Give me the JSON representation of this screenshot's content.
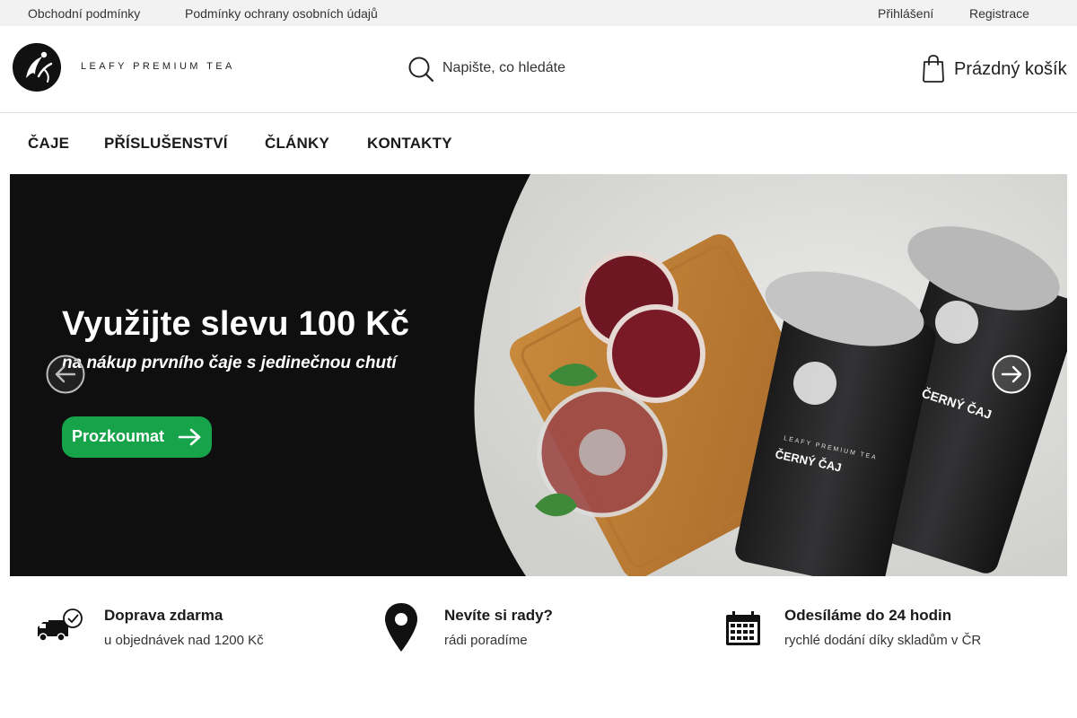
{
  "topbar": {
    "links_left": [
      "Obchodní podmínky",
      "Podmínky ochrany osobních údajů"
    ],
    "links_right": [
      "Přihlášení",
      "Registrace"
    ]
  },
  "header": {
    "logo_text": "LEAFY PREMIUM TEA",
    "search_placeholder": "Napište, co hledáte",
    "cart_label": "Prázdný košík"
  },
  "nav": {
    "items": [
      "ČAJE",
      "PŘÍSLUŠENSTVÍ",
      "ČLÁNKY",
      "KONTAKTY"
    ]
  },
  "banner": {
    "title": "Využijte slevu 100 Kč",
    "subtitle": "na nákup prvního čaje s jedinečnou chutí",
    "button_label": "Prozkoumat",
    "product_logo_text": "LEAFY PREMIUM TEA",
    "product_label": "ČERNÝ ČAJ",
    "colors": {
      "button": "#17a34a",
      "background": "#0f0f10"
    }
  },
  "features": [
    {
      "icon": "delivery-truck-icon",
      "title": "Doprava zdarma",
      "subtitle": "u objednávek nad 1200 Kč"
    },
    {
      "icon": "map-pin-icon",
      "title": "Nevíte si rady?",
      "subtitle": "rádi poradíme"
    },
    {
      "icon": "calendar-icon",
      "title": "Odesíláme do 24 hodin",
      "subtitle": "rychlé dodání díky skladům v ČR"
    }
  ]
}
